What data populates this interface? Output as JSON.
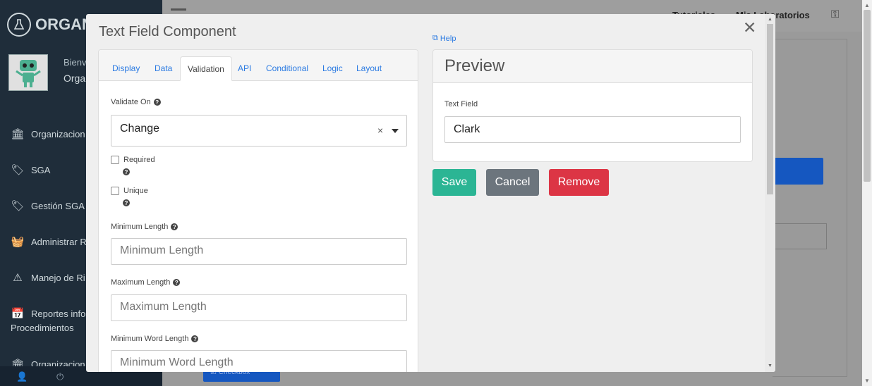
{
  "app": {
    "brand": "ORGAN",
    "user": {
      "greeting": "Bienv",
      "org": "Orga"
    },
    "sidebar": [
      {
        "label": "Organizacion",
        "icon": "bank-icon"
      },
      {
        "label": "SGA",
        "icon": "tags-icon"
      },
      {
        "label": "Gestión SGA",
        "icon": "tags-icon"
      },
      {
        "label": "Administrar R",
        "icon": "basket-icon"
      },
      {
        "label": "Manejo de Ri",
        "icon": "warning-icon"
      },
      {
        "label": "Reportes info",
        "label2": "Procedimientos",
        "icon": "calendar-check-icon"
      },
      {
        "label": "Organizacion",
        "icon": "bank-icon"
      }
    ],
    "topbar": {
      "link1": "Tutoriales",
      "link2": "Mis Laboratorios"
    },
    "bg_checkbox": "Checkbox"
  },
  "modal": {
    "title": "Text Field Component",
    "close": "✕",
    "tabs": [
      "Display",
      "Data",
      "Validation",
      "API",
      "Conditional",
      "Logic",
      "Layout"
    ],
    "active_tab": "Validation",
    "validate_on": {
      "label": "Validate On",
      "value": "Change"
    },
    "required": {
      "label": "Required"
    },
    "unique": {
      "label": "Unique"
    },
    "min_length": {
      "label": "Minimum Length",
      "placeholder": "Minimum Length"
    },
    "max_length": {
      "label": "Maximum Length",
      "placeholder": "Maximum Length"
    },
    "min_word_length": {
      "label": "Minimum Word Length",
      "placeholder": "Minimum Word Length"
    },
    "help": "Help",
    "preview": {
      "title": "Preview",
      "field_label": "Text Field",
      "field_value": "Clark"
    },
    "buttons": {
      "save": "Save",
      "cancel": "Cancel",
      "remove": "Remove"
    }
  },
  "colors": {
    "save": "#2bb594",
    "cancel": "#6c757d",
    "remove": "#dc3545",
    "link": "#2a7ae2",
    "sidebar": "#1f2d3a"
  }
}
